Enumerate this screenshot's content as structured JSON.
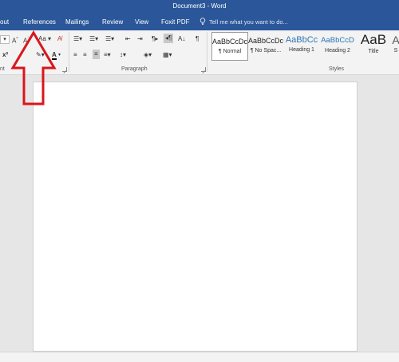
{
  "window": {
    "title": "Document3 - Word"
  },
  "tabs": [
    {
      "label": "out",
      "active": false
    },
    {
      "label": "References",
      "active": false
    },
    {
      "label": "Mailings",
      "active": false
    },
    {
      "label": "Review",
      "active": false
    },
    {
      "label": "View",
      "active": false
    },
    {
      "label": "Foxit PDF",
      "active": false
    }
  ],
  "tell_me": {
    "placeholder": "Tell me what you want to do..."
  },
  "ribbon": {
    "groups": {
      "font_label": "nt",
      "paragraph_label": "Paragraph",
      "styles_label": "Styles"
    },
    "styles": [
      {
        "sample": "AaBbCcDc",
        "name": "¶ Normal",
        "selected": true
      },
      {
        "sample": "AaBbCcDc",
        "name": "¶ No Spac...",
        "selected": false
      },
      {
        "sample": "AaBbCc",
        "name": "Heading 1",
        "selected": false
      },
      {
        "sample": "AaBbCcD",
        "name": "Heading 2",
        "selected": false
      },
      {
        "sample": "AaB",
        "name": "Title",
        "selected": false
      },
      {
        "sample": "A",
        "name": "S",
        "selected": false
      }
    ]
  },
  "colors": {
    "accent": "#2b579a",
    "annotation_arrow": "#d9161c",
    "heading_style": "#2e74b5"
  }
}
